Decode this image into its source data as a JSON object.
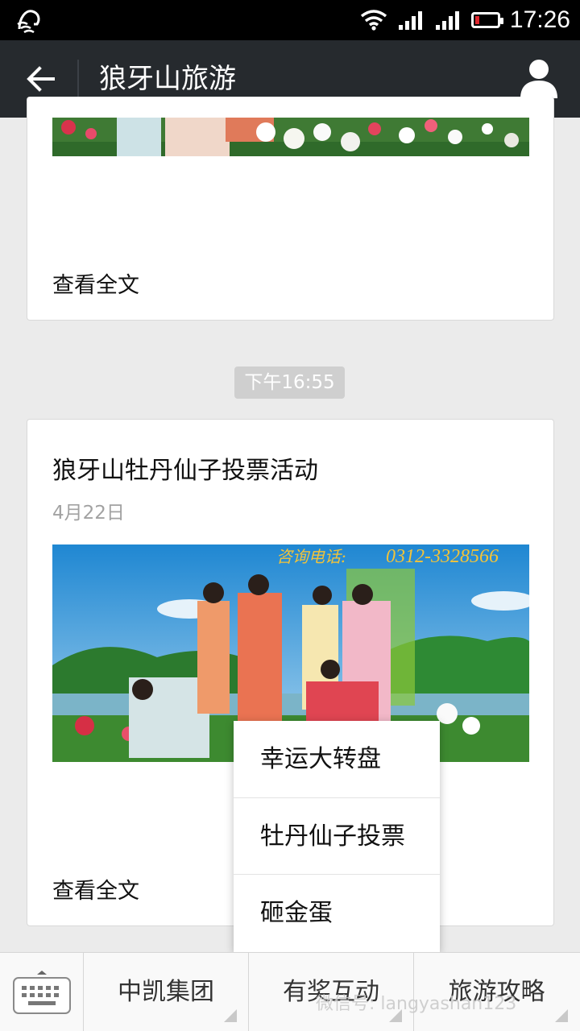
{
  "status_bar": {
    "time": "17:26",
    "battery_level_percent": 10
  },
  "header": {
    "title": "狼牙山旅游"
  },
  "feed": {
    "card1": {
      "read_more": "查看全文"
    },
    "timestamp": "下午16:55",
    "card2": {
      "title": "狼牙山牡丹仙子投票活动",
      "date": "4月22日",
      "image_caption": "咨询电话:",
      "image_phone": "0312-3328566",
      "read_more": "查看全文"
    }
  },
  "popup_menu": {
    "items": [
      "幸运大转盘",
      "牡丹仙子投票",
      "砸金蛋"
    ]
  },
  "bottom_menu": {
    "tabs": [
      "中凯集团",
      "有奖互动",
      "旅游攻略"
    ]
  },
  "watermark": "微信号: langyashan123"
}
